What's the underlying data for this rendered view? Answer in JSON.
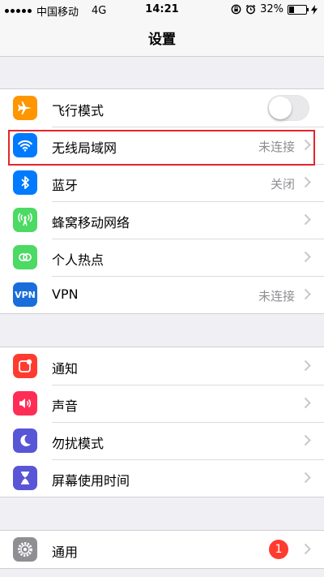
{
  "status_bar": {
    "carrier": "中国移动",
    "network": "4G",
    "time": "14:21",
    "battery": "32%",
    "battery_level_percent": 32,
    "icons": [
      "signal-dots-icon",
      "rotation-lock-icon",
      "alarm-icon",
      "battery-icon",
      "charging-bolt-icon"
    ]
  },
  "nav": {
    "title": "设置"
  },
  "group1": [
    {
      "label": "飞行模式",
      "icon": "airplane-icon",
      "color": "#ff9500",
      "control": "toggle",
      "toggle_on": false
    },
    {
      "label": "无线局域网",
      "icon": "wifi-icon",
      "color": "#007aff",
      "value": "未连接",
      "highlighted": true
    },
    {
      "label": "蓝牙",
      "icon": "bluetooth-icon",
      "color": "#007aff",
      "value": "关闭"
    },
    {
      "label": "蜂窝移动网络",
      "icon": "antenna-icon",
      "color": "#4cd964",
      "value": ""
    },
    {
      "label": "个人热点",
      "icon": "hotspot-link-icon",
      "color": "#4cd964",
      "value": ""
    },
    {
      "label": "VPN",
      "icon_text": "VPN",
      "icon": "vpn-icon",
      "color": "#1a6ddb",
      "value": "未连接"
    }
  ],
  "group2": [
    {
      "label": "通知",
      "icon": "notification-icon",
      "color": "#ff3b30"
    },
    {
      "label": "声音",
      "icon": "speaker-icon",
      "color": "#ff2d55"
    },
    {
      "label": "勿扰模式",
      "icon": "moon-icon",
      "color": "#5856d6"
    },
    {
      "label": "屏幕使用时间",
      "icon": "hourglass-icon",
      "color": "#5856d6"
    }
  ],
  "group3": [
    {
      "label": "通用",
      "icon": "gear-icon",
      "color": "#8e8e93",
      "badge": "1"
    }
  ],
  "colors": {
    "background": "#efeff4",
    "highlight_border": "#e4252c",
    "secondary_text": "#8e8e93",
    "chevron": "#c7c7cc"
  }
}
